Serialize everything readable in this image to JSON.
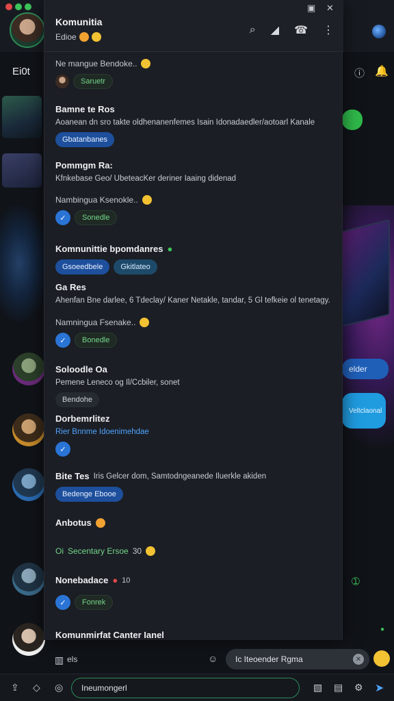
{
  "header": {
    "title": "Komunitia",
    "subtitle": "Edioe",
    "sub_title_left": "Ei0t"
  },
  "colors": {
    "accent": "#2a74d6",
    "green": "#2e8b57",
    "panel": "#1b1e24"
  },
  "messages": [
    {
      "sub": "Ne mangue Bendoke..",
      "chip": "Saruetr"
    },
    {
      "name": "Bamne te Ros",
      "text": "Aoanean dn sro takte oldhenanenfemes Isain Idonadaedler/aotoarl Kanale",
      "chip": "Gbatanbanes"
    },
    {
      "name": "Pommgm Ra:",
      "text": "Kfnkebase Geo/ UbeteacKer deriner Iaaing didenad"
    },
    {
      "sub": "Nambingua Ksenokle..",
      "chip": "Sonedle"
    },
    {
      "name": "Komnunittie bpomdanres",
      "chips": [
        "Gsoeedbele",
        "Gkitlateo"
      ]
    },
    {
      "name": "Ga Res",
      "text": "Ahenfan Bne darlee, 6 Tdeclay/ Kaner Netakle, tandar, 5 Gl tefkeie ol tenetagy."
    },
    {
      "sub": "Namningua Fsenake..",
      "chip": "Bonedle"
    },
    {
      "name": "Soloodle Oa",
      "text": "Pemene Leneco og Il/Ccbiler, sonet",
      "chip": "Bendohe"
    },
    {
      "name": "Dorbemrlitez",
      "text": "Rier Bnnme Idoenimehdae"
    },
    {
      "name": "Bite Tes",
      "text": "Iris Gelcer dom, Samtodngeanede Iluerkle akiden",
      "chip": "Bedenge Ebooe"
    },
    {
      "name": "Anbotus"
    },
    {
      "sub": "Secentary Ersoe",
      "sub_num": "30",
      "sub_lead": "Oi"
    },
    {
      "name": "Nonebadace",
      "name_num": "10",
      "chip": "Fonrek"
    },
    {
      "name": "Komunmirfat Canter Ianel"
    }
  ],
  "right_bubbles": {
    "b1": "elder",
    "b2": "Veltclaonal"
  },
  "composer": {
    "left_label": "els",
    "pill": "Ic Iteoender Rgma"
  },
  "bottom_input": {
    "placeholder": "Ineumongerl"
  },
  "icons": [
    "search-icon",
    "megaphone-icon",
    "phone-icon",
    "more-icon",
    "globe-icon",
    "notifications-icon",
    "send-icon",
    "attach-icon",
    "emoji-icon"
  ]
}
